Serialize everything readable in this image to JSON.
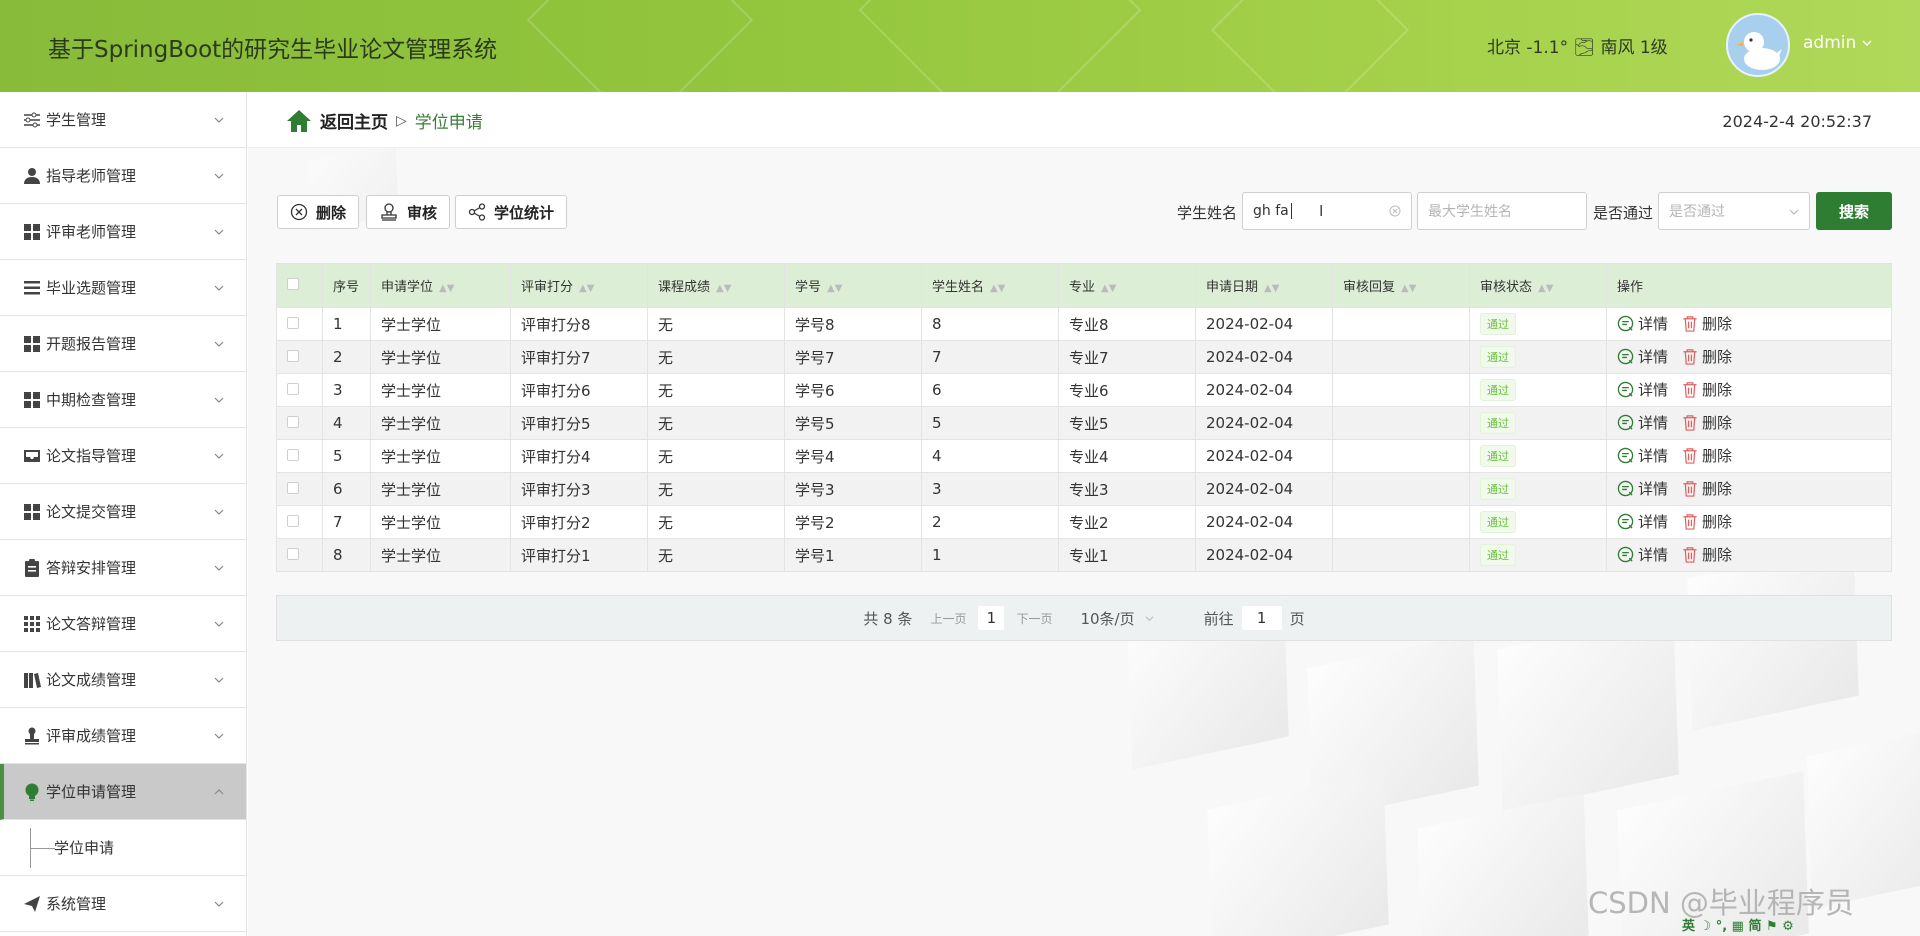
{
  "header": {
    "title": "基于SpringBoot的研究生毕业论文管理系统",
    "weather": "北京 -1.1° 🌫 南风 1级",
    "username": "admin"
  },
  "sidebar": {
    "items": [
      {
        "label": "学生管理",
        "icon": "sliders-icon"
      },
      {
        "label": "指导老师管理",
        "icon": "person-icon"
      },
      {
        "label": "评审老师管理",
        "icon": "grid-icon"
      },
      {
        "label": "毕业选题管理",
        "icon": "list-icon"
      },
      {
        "label": "开题报告管理",
        "icon": "grid-icon"
      },
      {
        "label": "中期检查管理",
        "icon": "grid-icon"
      },
      {
        "label": "论文指导管理",
        "icon": "inbox-icon"
      },
      {
        "label": "论文提交管理",
        "icon": "grid-icon"
      },
      {
        "label": "答辩安排管理",
        "icon": "clipboard-icon"
      },
      {
        "label": "论文答辩管理",
        "icon": "dots-grid-icon"
      },
      {
        "label": "论文成绩管理",
        "icon": "books-icon"
      },
      {
        "label": "评审成绩管理",
        "icon": "stamp-icon"
      },
      {
        "label": "学位申请管理",
        "icon": "bulb-icon"
      },
      {
        "label": "系统管理",
        "icon": "send-icon"
      }
    ],
    "sub_item": "学位申请"
  },
  "breadcrumb": {
    "home": "返回主页",
    "separator": "▷",
    "current": "学位申请"
  },
  "datetime": "2024-2-4 20:52:37",
  "toolbar": {
    "delete": "删除",
    "audit": "审核",
    "stats": "学位统计"
  },
  "search": {
    "name_label": "学生姓名",
    "name_value": "gh fa",
    "max_name_placeholder": "最大学生姓名",
    "pass_label": "是否通过",
    "pass_placeholder": "是否通过",
    "button": "搜索"
  },
  "table": {
    "headers": [
      "序号",
      "申请学位",
      "评审打分",
      "课程成绩",
      "学号",
      "学生姓名",
      "专业",
      "申请日期",
      "审核回复",
      "审核状态",
      "操作"
    ],
    "rows": [
      {
        "no": "1",
        "degree": "学士学位",
        "score": "评审打分8",
        "course": "无",
        "sid": "学号8",
        "name": "8",
        "major": "专业8",
        "date": "2024-02-04",
        "reply": "",
        "status": "通过"
      },
      {
        "no": "2",
        "degree": "学士学位",
        "score": "评审打分7",
        "course": "无",
        "sid": "学号7",
        "name": "7",
        "major": "专业7",
        "date": "2024-02-04",
        "reply": "",
        "status": "通过"
      },
      {
        "no": "3",
        "degree": "学士学位",
        "score": "评审打分6",
        "course": "无",
        "sid": "学号6",
        "name": "6",
        "major": "专业6",
        "date": "2024-02-04",
        "reply": "",
        "status": "通过"
      },
      {
        "no": "4",
        "degree": "学士学位",
        "score": "评审打分5",
        "course": "无",
        "sid": "学号5",
        "name": "5",
        "major": "专业5",
        "date": "2024-02-04",
        "reply": "",
        "status": "通过"
      },
      {
        "no": "5",
        "degree": "学士学位",
        "score": "评审打分4",
        "course": "无",
        "sid": "学号4",
        "name": "4",
        "major": "专业4",
        "date": "2024-02-04",
        "reply": "",
        "status": "通过"
      },
      {
        "no": "6",
        "degree": "学士学位",
        "score": "评审打分3",
        "course": "无",
        "sid": "学号3",
        "name": "3",
        "major": "专业3",
        "date": "2024-02-04",
        "reply": "",
        "status": "通过"
      },
      {
        "no": "7",
        "degree": "学士学位",
        "score": "评审打分2",
        "course": "无",
        "sid": "学号2",
        "name": "2",
        "major": "专业2",
        "date": "2024-02-04",
        "reply": "",
        "status": "通过"
      },
      {
        "no": "8",
        "degree": "学士学位",
        "score": "评审打分1",
        "course": "无",
        "sid": "学号1",
        "name": "1",
        "major": "专业1",
        "date": "2024-02-04",
        "reply": "",
        "status": "通过"
      }
    ],
    "op_detail": "详情",
    "op_delete": "删除"
  },
  "pagination": {
    "total": "共 8 条",
    "prev": "上一页",
    "current_page": "1",
    "next": "下一页",
    "page_size": "10条/页",
    "goto_label": "前往",
    "goto_value": "1",
    "page_unit": "页"
  },
  "watermark": "CSDN @毕业程序员",
  "tray": "英 ☽ °, ▦ 简 ⚑ ⚙",
  "colors": {
    "header": "#93c63d",
    "accent": "#2f7d32",
    "table_header": "#dcefd6"
  }
}
